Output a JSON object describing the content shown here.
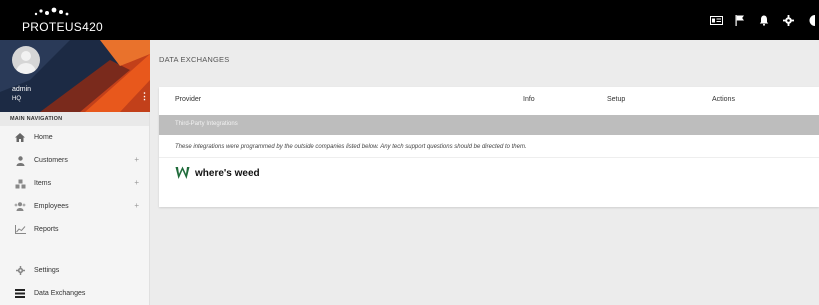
{
  "app": {
    "logo_text": "PROTEUS420"
  },
  "topbar": {
    "icons": [
      "id-card-icon",
      "flag-icon",
      "bell-icon",
      "gear-icon",
      "user-icon"
    ]
  },
  "profile": {
    "name": "admin",
    "location": "HQ",
    "menu_glyph": "⋮"
  },
  "sidebar": {
    "title": "MAIN NAVIGATION",
    "items": [
      {
        "label": "Home",
        "icon": "home-icon",
        "expandable": false
      },
      {
        "label": "Customers",
        "icon": "user-icon",
        "expandable": true
      },
      {
        "label": "Items",
        "icon": "items-icon",
        "expandable": true
      },
      {
        "label": "Employees",
        "icon": "employees-icon",
        "expandable": true
      },
      {
        "label": "Reports",
        "icon": "chart-icon",
        "expandable": false
      }
    ],
    "items2": [
      {
        "label": "Settings",
        "icon": "gear-icon"
      },
      {
        "label": "Data Exchanges",
        "icon": "list-icon"
      }
    ],
    "plus_glyph": "+"
  },
  "main": {
    "title": "DATA EXCHANGES",
    "table": {
      "headers": {
        "provider": "Provider",
        "info": "Info",
        "setup": "Setup",
        "actions": "Actions"
      },
      "group_label": "Third-Party Integrations",
      "note": "These integrations were programmed by the outside companies listed below. Any tech support questions should be directed to them.",
      "providers": [
        {
          "name": "where's weed",
          "logo_glyph": "W"
        }
      ]
    }
  },
  "colors": {
    "topbar": "#000000",
    "accent": "#e8581c",
    "group_row": "#bdbdbd"
  }
}
